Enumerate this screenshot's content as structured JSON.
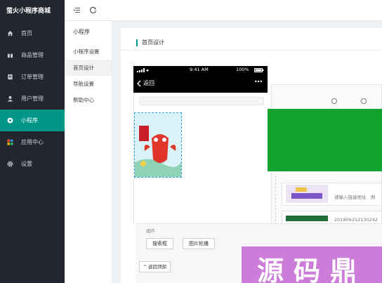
{
  "app": {
    "brand": "萤火小程序商城"
  },
  "sidebar": {
    "items": [
      {
        "label": "首页",
        "icon": "home-icon",
        "active": false
      },
      {
        "label": "商品管理",
        "icon": "gift-icon",
        "active": false
      },
      {
        "label": "订单管理",
        "icon": "order-icon",
        "active": false
      },
      {
        "label": "用户管理",
        "icon": "user-icon",
        "active": false
      },
      {
        "label": "小程序",
        "icon": "miniprogram-icon",
        "active": true
      },
      {
        "label": "应用中心",
        "icon": "apps-icon",
        "active": false
      },
      {
        "label": "设置",
        "icon": "gear-icon",
        "active": false
      }
    ]
  },
  "topbar": {
    "icons": [
      "collapse-menu-icon",
      "refresh-icon"
    ]
  },
  "submenu": {
    "title": "小程序",
    "items": [
      {
        "label": "小程序设置",
        "active": false
      },
      {
        "label": "首页设计",
        "active": true
      },
      {
        "label": "导航设置",
        "active": false
      },
      {
        "label": "帮助中心",
        "active": false
      }
    ]
  },
  "card": {
    "title": "首页设计"
  },
  "phone": {
    "time": "9:41 AM",
    "battery": "100%",
    "back_label": "返回",
    "menu_glyph": "•••"
  },
  "editor": {
    "link_placeholder": "请输入链接地址",
    "link_placeholder_suffix": "例",
    "image_id": "201806252130242"
  },
  "components": {
    "title": "组件",
    "buttons": [
      "搜索框",
      "图片轮播"
    ],
    "back_top": "返回顶部"
  },
  "watermark": {
    "text": "源码鼎"
  },
  "colors": {
    "accent": "#009688",
    "sidebar": "#23262e",
    "green_block": "#11a32f",
    "watermark": "#cc7dd9"
  }
}
